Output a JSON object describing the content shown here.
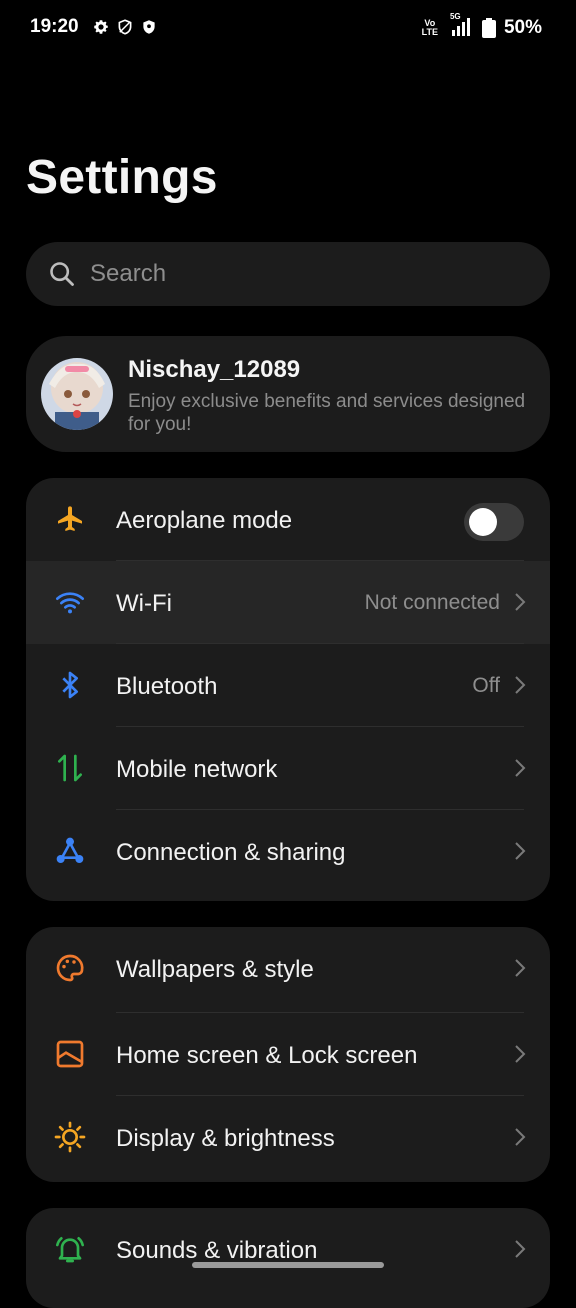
{
  "status_bar": {
    "time": "19:20",
    "left_icons": [
      "gear-icon",
      "shield-outline-icon",
      "shield-filled-icon"
    ],
    "volte_top": "Vo",
    "volte_bottom": "LTE",
    "network": "5G",
    "battery_percent": "50%"
  },
  "page": {
    "title": "Settings"
  },
  "search": {
    "placeholder": "Search"
  },
  "profile": {
    "name": "Nischay_12089",
    "subtitle": "Enjoy exclusive benefits and services designed for you!"
  },
  "connectivity": {
    "items": [
      {
        "label": "Aeroplane mode",
        "icon": "airplane-icon",
        "toggle_on": false,
        "color": "#f5a623"
      },
      {
        "label": "Wi-Fi",
        "icon": "wifi-icon",
        "value": "Not connected",
        "color": "#3b82f6"
      },
      {
        "label": "Bluetooth",
        "icon": "bluetooth-icon",
        "value": "Off",
        "color": "#3b82f6"
      },
      {
        "label": "Mobile network",
        "icon": "mobile-data-icon",
        "color": "#2fb24f"
      },
      {
        "label": "Connection & sharing",
        "icon": "share-connection-icon",
        "color": "#3b82f6"
      }
    ]
  },
  "personalization": {
    "items": [
      {
        "label": "Wallpapers & style",
        "icon": "palette-icon",
        "color": "#f07a2e"
      },
      {
        "label": "Home screen & Lock screen",
        "icon": "home-screen-icon",
        "color": "#f07a2e"
      },
      {
        "label": "Display & brightness",
        "icon": "brightness-icon",
        "color": "#f5a623"
      }
    ]
  },
  "sound": {
    "items": [
      {
        "label": "Sounds & vibration",
        "icon": "bell-ringing-icon",
        "color": "#2fb24f"
      }
    ]
  }
}
